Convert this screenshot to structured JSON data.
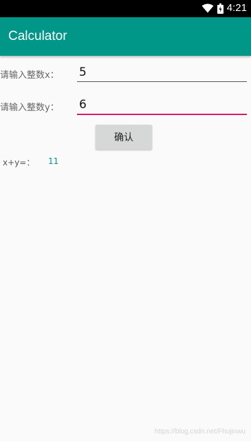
{
  "status_bar": {
    "time": "4:21",
    "icons": [
      "wifi-icon",
      "battery-icon"
    ]
  },
  "app_bar": {
    "title": "Calculator",
    "color": "#009688"
  },
  "form": {
    "x_label": "请输入整数x：",
    "x_value": "5",
    "y_label": "请输入整数y：",
    "y_value": "6",
    "confirm_label": "确认"
  },
  "result": {
    "label": "x+y=：",
    "value": "11"
  },
  "watermark": "https://blog.csdn.net/Fhujinwu",
  "colors": {
    "accent": "#d81b60",
    "primary": "#009688"
  }
}
